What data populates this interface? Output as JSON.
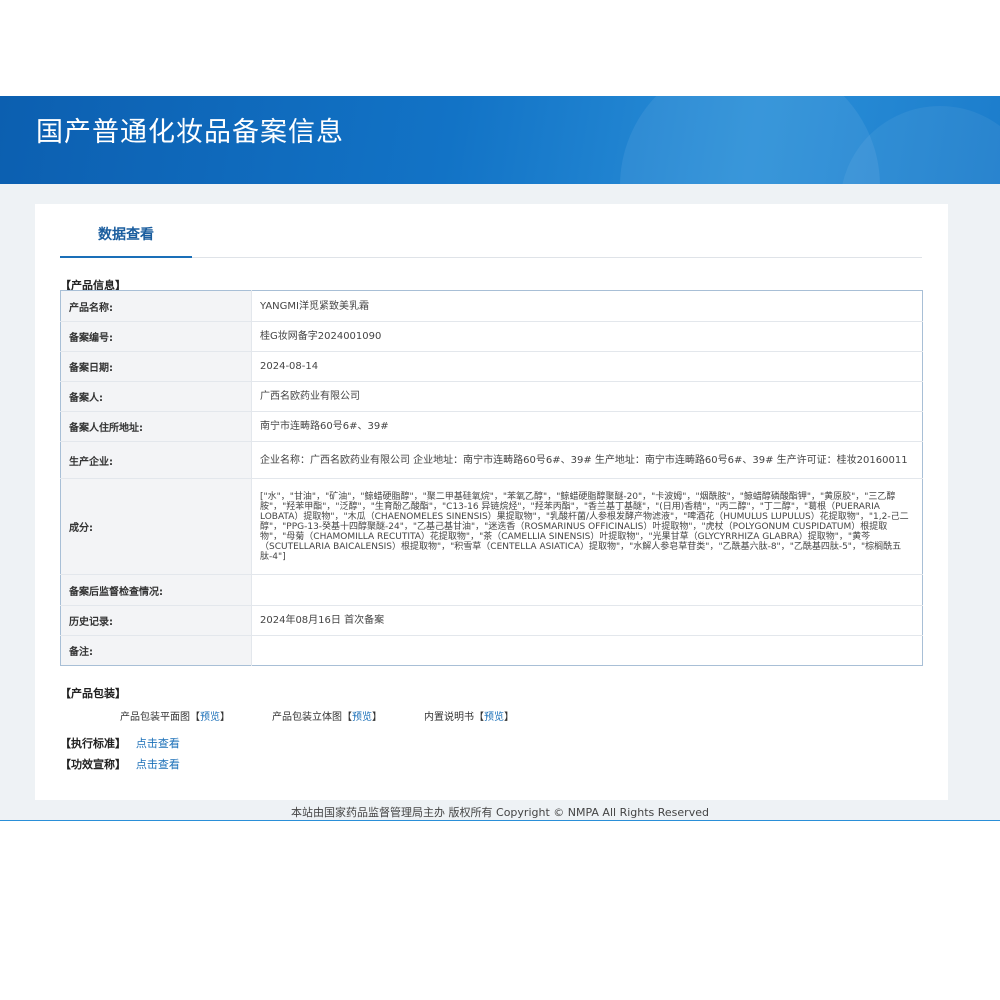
{
  "banner": {
    "title": "国产普通化妆品备案信息"
  },
  "tabs": [
    {
      "label": "数据查看"
    }
  ],
  "product_info": {
    "heading": "【产品信息】",
    "rows": [
      {
        "label": "产品名称:",
        "value": "YANGMI洋觅紧致美乳霜"
      },
      {
        "label": "备案编号:",
        "value": "桂G妆网备字2024001090"
      },
      {
        "label": "备案日期:",
        "value": "2024-08-14"
      },
      {
        "label": "备案人:",
        "value": "广西名欧药业有限公司"
      },
      {
        "label": "备案人住所地址:",
        "value": "南宁市连畴路60号6#、39#"
      },
      {
        "label": "生产企业:",
        "value": "企业名称：广西名欧药业有限公司 企业地址：南宁市连畴路60号6#、39# 生产地址：南宁市连畴路60号6#、39# 生产许可证：桂妆20160011"
      },
      {
        "label": "成分:",
        "value": "[\"水\"，\"甘油\"，\"矿油\"，\"鲸蜡硬脂醇\"，\"聚二甲基硅氧烷\"，\"苯氧乙醇\"，\"鲸蜡硬脂醇聚醚-20\"，\"卡波姆\"，\"烟酰胺\"，\"鲸蜡醇磷酸酯钾\"，\"黄原胶\"，\"三乙醇胺\"，\"羟苯甲酯\"，\"泛醇\"，\"生育酚乙酸酯\"，\"C13-16 异链烷烃\"，\"羟苯丙酯\"，\"香兰基丁基醚\"，\"(日用)香精\"，\"丙二醇\"，\"丁二醇\"，\"葛根（PUERARIA LOBATA）提取物\"，\"木瓜（CHAENOMELES SINENSIS）果提取物\"，\"乳酸杆菌/人参根发酵产物滤液\"，\"啤酒花（HUMULUS LUPULUS）花提取物\"，\"1,2-己二醇\"，\"PPG-13-癸基十四醇聚醚-24\"，\"乙基己基甘油\"，\"迷迭香（ROSMARINUS OFFICINALIS）叶提取物\"，\"虎杖（POLYGONUM CUSPIDATUM）根提取物\"，\"母菊（CHAMOMILLA RECUTITA）花提取物\"，\"茶（CAMELLIA SINENSIS）叶提取物\"，\"光果甘草（GLYCYRRHIZA GLABRA）提取物\"，\"黄芩（SCUTELLARIA BAICALENSIS）根提取物\"，\"积雪草（CENTELLA ASIATICA）提取物\"，\"水解人参皂草苷类\"，\"乙酰基六肽-8\"，\"乙酰基四肽-5\"，\"棕榈酰五肽-4\"]"
      },
      {
        "label": "备案后监督检查情况:",
        "value": ""
      },
      {
        "label": "历史记录:",
        "value": "2024年08月16日 首次备案"
      },
      {
        "label": "备注:",
        "value": ""
      }
    ]
  },
  "packaging": {
    "heading": "【产品包装】",
    "items": [
      {
        "label": "产品包装平面图",
        "link": "预览"
      },
      {
        "label": "产品包装立体图",
        "link": "预览"
      },
      {
        "label": "内置说明书",
        "link": "预览"
      }
    ]
  },
  "standard": {
    "heading": "【执行标准】",
    "link": "点击查看"
  },
  "efficacy": {
    "heading": "【功效宣称】",
    "link": "点击查看"
  },
  "footer": {
    "text": "本站由国家药品监督管理局主办 版权所有 Copyright © NMPA All Rights Reserved"
  }
}
